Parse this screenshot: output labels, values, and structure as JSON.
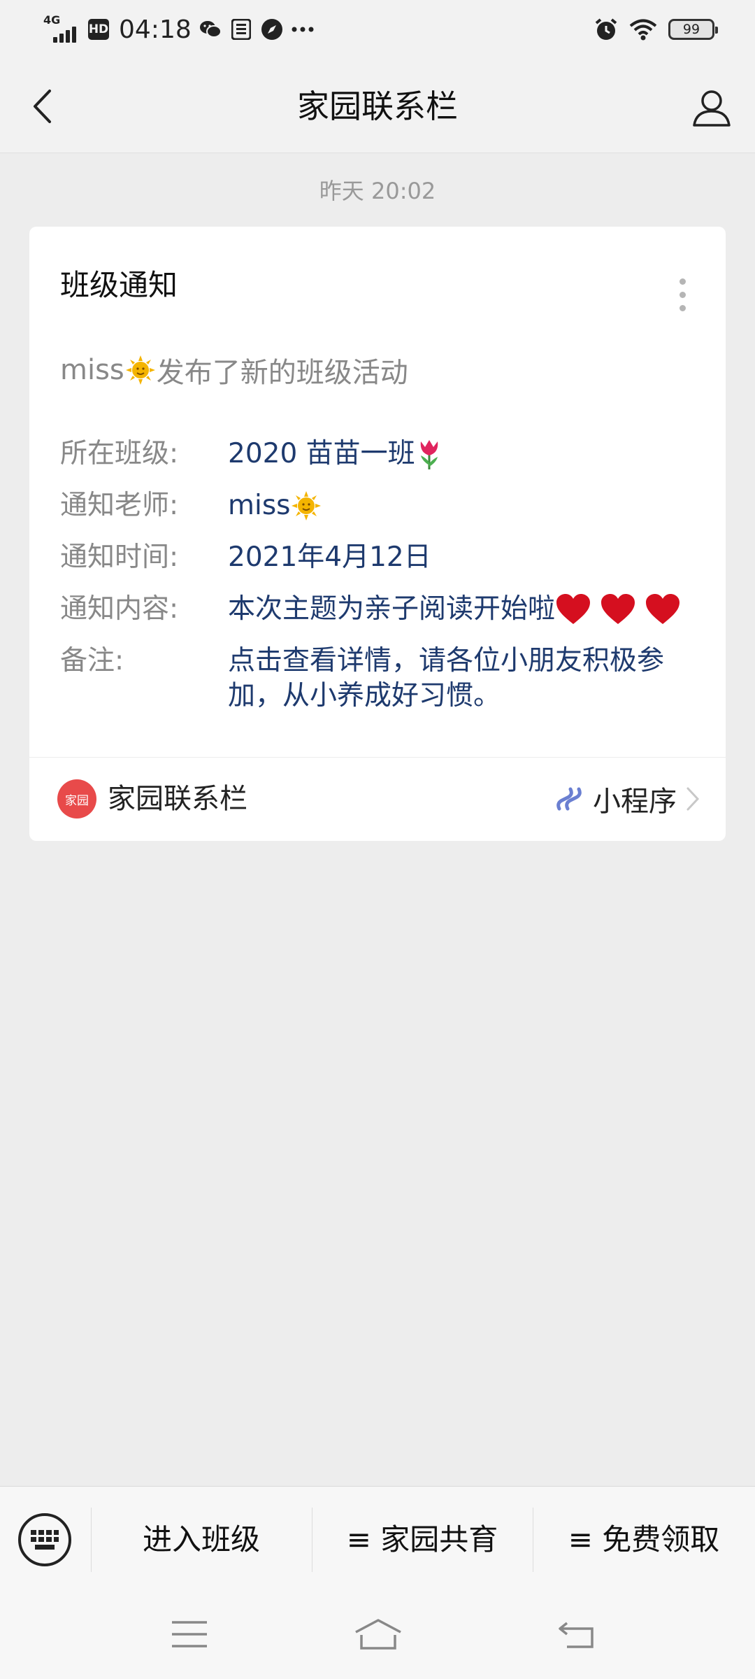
{
  "status_bar": {
    "network": "4G",
    "hd": "HD",
    "time": "04:18",
    "battery": "99",
    "icons": [
      "signal-icon",
      "hd-icon",
      "wechat-icon",
      "app-icon",
      "compass-icon",
      "more-dots-icon",
      "alarm-icon",
      "wifi-icon",
      "battery-icon"
    ]
  },
  "nav": {
    "title": "家园联系栏"
  },
  "timestamp": "昨天 20:02",
  "card": {
    "title": "班级通知",
    "subtitle_name": "miss",
    "subtitle_text": "发布了新的班级活动",
    "fields": {
      "class_label": "所在班级:",
      "class_value": "2020 苗苗一班",
      "teacher_label": "通知老师:",
      "teacher_value": "miss",
      "time_label": "通知时间:",
      "time_value": "2021年4月12日",
      "content_label": "通知内容:",
      "content_value": "本次主题为亲子阅读开始啦",
      "note_label": "备注:",
      "note_value": "点击查看详情，请各位小朋友积极参加，从小养成好习惯。"
    },
    "footer": {
      "logo_text": "家园",
      "app_name": "家园联系栏",
      "mini_program": "小程序"
    }
  },
  "bottom_menu": {
    "items": [
      "进入班级",
      "≡ 家园共育",
      "≡ 免费领取"
    ]
  },
  "colors": {
    "value_text": "#1e3a6e",
    "label_text": "#888888",
    "logo_red": "#e84a4a",
    "page_bg": "#ededed"
  }
}
